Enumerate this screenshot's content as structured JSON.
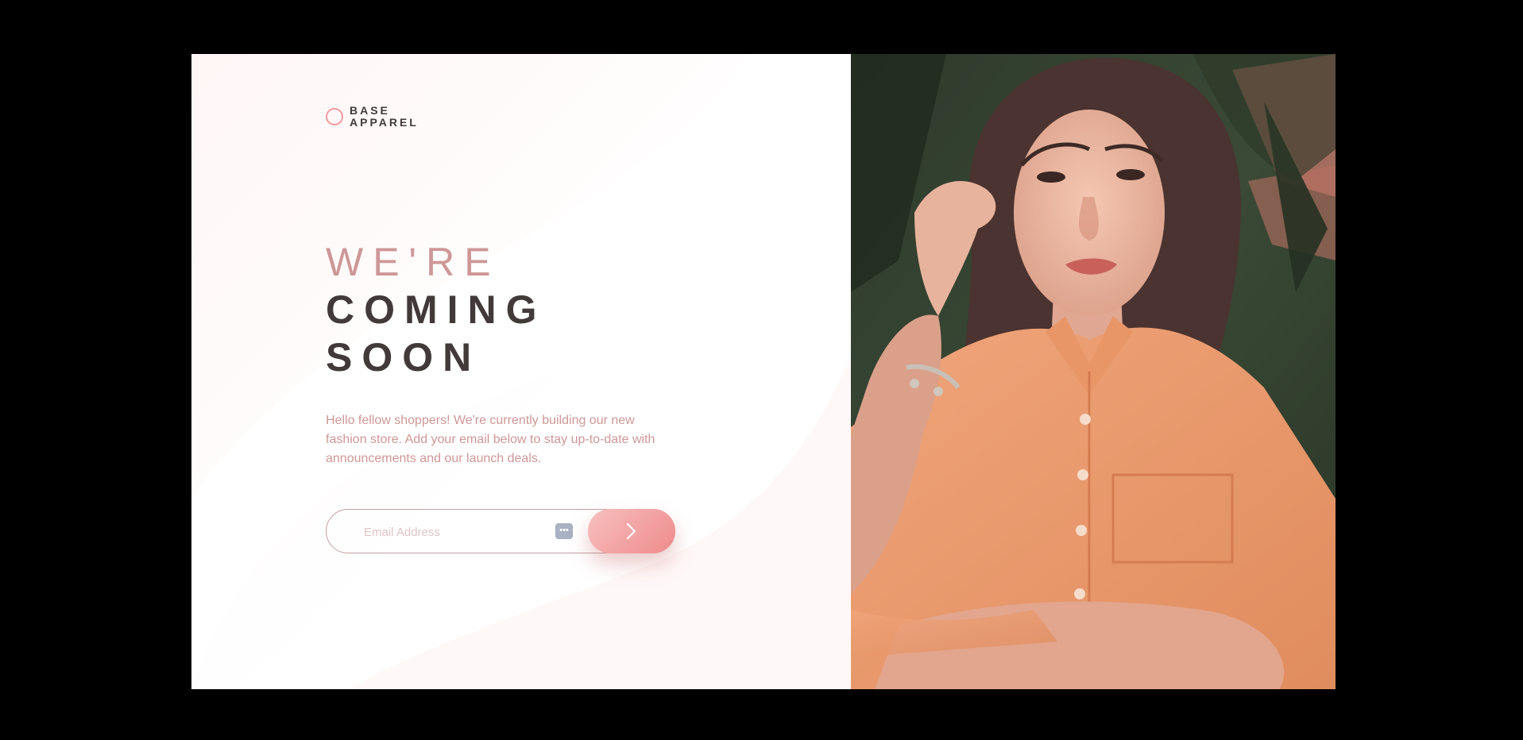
{
  "brand": {
    "line1": "BASE",
    "line2": "APPAREL"
  },
  "headline": {
    "light": "WE'RE",
    "bold1": "COMING",
    "bold2": "SOON"
  },
  "description": "Hello fellow shoppers! We're currently building our new fashion store. Add your email below to stay up-to-date with announcements and our launch deals.",
  "form": {
    "email_placeholder": "Email Address",
    "password_manager_icon": "ellipsis-key-icon",
    "submit_icon": "chevron-right-icon"
  },
  "hero_image": {
    "alt": "Woman in an orange shirt"
  },
  "colors": {
    "accent": "#ce9797",
    "dark": "#423a3a",
    "button_start": "#f8bfbf",
    "button_end": "#ee8b8b",
    "shirt": "#e99a6e"
  }
}
